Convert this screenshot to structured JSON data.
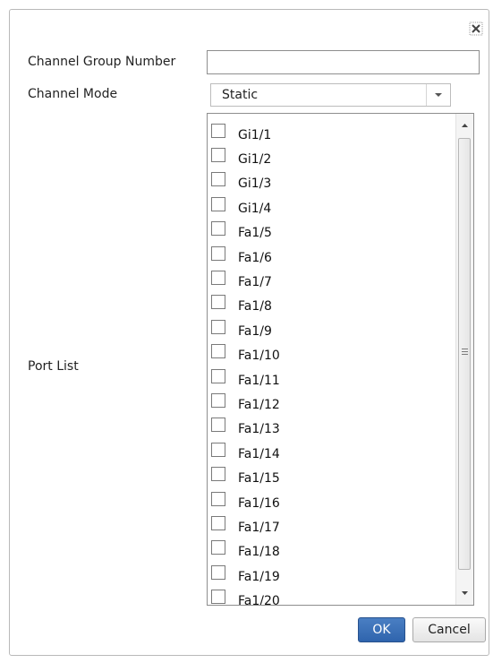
{
  "dialog": {
    "channel_group_label": "Channel Group Number",
    "channel_group_value": "",
    "channel_mode_label": "Channel Mode",
    "channel_mode_value": "Static",
    "port_list_label": "Port List",
    "ok_label": "OK",
    "cancel_label": "Cancel"
  },
  "ports": [
    {
      "label": "Gi1/1",
      "checked": false
    },
    {
      "label": "Gi1/2",
      "checked": false
    },
    {
      "label": "Gi1/3",
      "checked": false
    },
    {
      "label": "Gi1/4",
      "checked": false
    },
    {
      "label": "Fa1/5",
      "checked": false
    },
    {
      "label": "Fa1/6",
      "checked": false
    },
    {
      "label": "Fa1/7",
      "checked": false
    },
    {
      "label": "Fa1/8",
      "checked": false
    },
    {
      "label": "Fa1/9",
      "checked": false
    },
    {
      "label": "Fa1/10",
      "checked": false
    },
    {
      "label": "Fa1/11",
      "checked": false
    },
    {
      "label": "Fa1/12",
      "checked": false
    },
    {
      "label": "Fa1/13",
      "checked": false
    },
    {
      "label": "Fa1/14",
      "checked": false
    },
    {
      "label": "Fa1/15",
      "checked": false
    },
    {
      "label": "Fa1/16",
      "checked": false
    },
    {
      "label": "Fa1/17",
      "checked": false
    },
    {
      "label": "Fa1/18",
      "checked": false
    },
    {
      "label": "Fa1/19",
      "checked": false
    },
    {
      "label": "Fa1/20",
      "checked": false
    }
  ],
  "icons": {
    "close": "close-icon",
    "dropdown": "chevron-down-icon",
    "scroll_up": "scroll-up-arrow-icon",
    "scroll_down": "scroll-down-arrow-icon"
  },
  "colors": {
    "primary_button": "#3a6fb6",
    "border": "#8e8e8e"
  }
}
